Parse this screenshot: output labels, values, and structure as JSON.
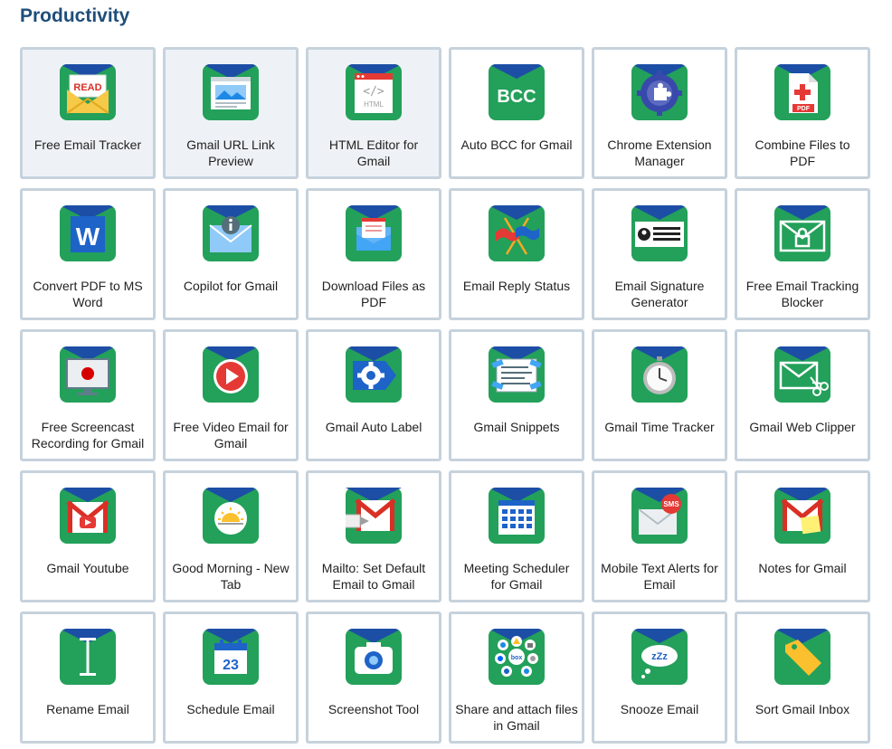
{
  "page": {
    "title": "Productivity"
  },
  "tiles": [
    {
      "label": "Free Email Tracker",
      "icon": "read-envelope-icon"
    },
    {
      "label": "Gmail URL Link Preview",
      "icon": "link-preview-icon"
    },
    {
      "label": "HTML Editor for Gmail",
      "icon": "html-editor-icon",
      "icon_text": "HTML"
    },
    {
      "label": "Auto BCC for Gmail",
      "icon": "bcc-icon",
      "icon_text": "BCC"
    },
    {
      "label": "Chrome Extension Manager",
      "icon": "puzzle-gear-icon"
    },
    {
      "label": "Combine Files to PDF",
      "icon": "pdf-file-icon",
      "icon_text": "PDF"
    },
    {
      "label": "Convert PDF to MS Word",
      "icon": "word-icon",
      "icon_text": "W"
    },
    {
      "label": "Copilot for Gmail",
      "icon": "info-envelope-icon"
    },
    {
      "label": "Download Files as PDF",
      "icon": "download-envelope-icon"
    },
    {
      "label": "Email Reply Status",
      "icon": "flags-icon"
    },
    {
      "label": "Email Signature Generator",
      "icon": "signature-card-icon"
    },
    {
      "label": "Free Email Tracking Blocker",
      "icon": "lock-envelope-icon"
    },
    {
      "label": "Free Screencast Recording for Gmail",
      "icon": "screen-record-icon"
    },
    {
      "label": "Free Video Email for Gmail",
      "icon": "play-button-icon"
    },
    {
      "label": "Gmail Auto Label",
      "icon": "gear-label-icon"
    },
    {
      "label": "Gmail Snippets",
      "icon": "snippet-window-icon"
    },
    {
      "label": "Gmail Time Tracker",
      "icon": "stopwatch-icon"
    },
    {
      "label": "Gmail Web Clipper",
      "icon": "scissors-envelope-icon"
    },
    {
      "label": "Gmail Youtube",
      "icon": "youtube-gmail-icon"
    },
    {
      "label": "Good Morning - New Tab",
      "icon": "sunrise-icon"
    },
    {
      "label": "Mailto: Set Default Email to Gmail",
      "icon": "mailto-icon"
    },
    {
      "label": "Meeting Scheduler for Gmail",
      "icon": "calendar-grid-icon"
    },
    {
      "label": "Mobile Text Alerts for Email",
      "icon": "sms-envelope-icon",
      "icon_text": "SMS"
    },
    {
      "label": "Notes for Gmail",
      "icon": "gmail-note-icon"
    },
    {
      "label": "Rename Email",
      "icon": "text-cursor-icon"
    },
    {
      "label": "Schedule Email",
      "icon": "calendar-date-icon",
      "icon_text": "23"
    },
    {
      "label": "Screenshot Tool",
      "icon": "camera-icon"
    },
    {
      "label": "Share and attach files in Gmail",
      "icon": "cloud-services-icon",
      "icon_text": "box"
    },
    {
      "label": "Snooze Email",
      "icon": "snooze-cloud-icon",
      "icon_text": "zZz"
    },
    {
      "label": "Sort Gmail Inbox",
      "icon": "tag-icon"
    }
  ],
  "colors": {
    "title": "#1f4e79",
    "tile_border": "#c6d2dc",
    "tile_highlight": "#eef2f6",
    "icon_green": "#23a05a",
    "icon_blue": "#1d4ea5",
    "gmail_red": "#d93025"
  }
}
